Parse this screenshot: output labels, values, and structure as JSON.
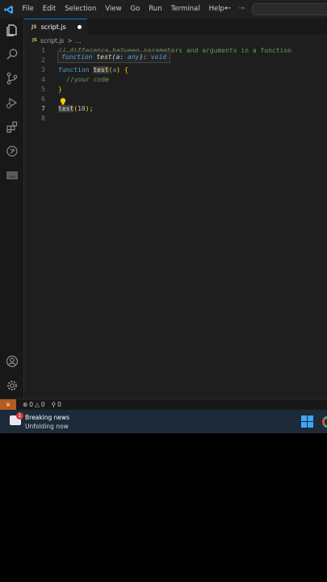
{
  "titlebar": {
    "menu": [
      "File",
      "Edit",
      "Selection",
      "View",
      "Go",
      "Run",
      "Terminal",
      "Help"
    ]
  },
  "tabs": [
    {
      "label": "script.js",
      "badge": "JS",
      "modified": true
    }
  ],
  "breadcrumb": {
    "badge": "JS",
    "file": "script.js",
    "sep": ">",
    "more": "..."
  },
  "editor": {
    "line_numbers": [
      "1",
      "2",
      "3",
      "4",
      "5",
      "6",
      "7",
      "8"
    ],
    "comment_line": "// difference between parameters and arguments in a function",
    "kw_function": "function",
    "fn_name": "test",
    "param": "a",
    "open_paren": "(",
    "close_paren": ")",
    "open_brace": "{",
    "close_brace": "}",
    "body_comment": "//your code",
    "call_arg": "10",
    "call_end": ";",
    "hover": {
      "kw": "function",
      "name": "test",
      "param": "a",
      "type": "any",
      "ret": "void"
    }
  },
  "statusbar": {
    "errors": "0",
    "warnings": "0",
    "ports": "0"
  },
  "taskbar": {
    "badge": "1",
    "news_title": "Breaking news",
    "news_subtitle": "Unfolding now"
  },
  "icons": {
    "logo": "vscode-logo-icon",
    "activity": [
      "explorer-icon",
      "search-icon",
      "source-control-icon",
      "run-debug-icon",
      "extensions-icon",
      "remote-icon",
      "env-icon",
      "account-icon",
      "settings-gear-icon"
    ]
  },
  "colors": {
    "accent": "#0078d4",
    "remote": "#b35a1f",
    "keyword": "#569cd6",
    "function": "#dcdcaa",
    "comment": "#6a9955"
  }
}
